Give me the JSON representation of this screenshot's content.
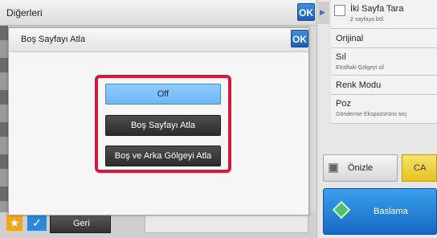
{
  "header": {
    "title": "Diğerleri",
    "ok_label": "OK"
  },
  "dialog": {
    "title": "Boş Sayfayı Atla",
    "ok_label": "OK",
    "options": [
      {
        "label": "Off",
        "selected": true
      },
      {
        "label": "Boş Sayfayı Atla",
        "selected": false
      },
      {
        "label": "Boş ve Arka Gölgeyi Atla",
        "selected": false
      }
    ]
  },
  "right_panel": {
    "items": [
      {
        "label": "İki Sayfa Tara",
        "sub": "2 sayfaya böl"
      },
      {
        "label": "Orijinal",
        "sub": ""
      },
      {
        "label": "Sıl",
        "sub": "Etraftaki Gölgeyi sil"
      },
      {
        "label": "Renk Modu",
        "sub": ""
      },
      {
        "label": "Poz",
        "sub": "Gönderme Ekspozürünü seç"
      }
    ],
    "preview_label": "Önizle",
    "ca_label": "CA",
    "start_label": "Baslama"
  },
  "bottom": {
    "back_label": "Geri"
  },
  "colors": {
    "highlight_red": "#d9163b",
    "accent_blue": "#2f87d9",
    "selected_blue": "#8ecbff"
  }
}
